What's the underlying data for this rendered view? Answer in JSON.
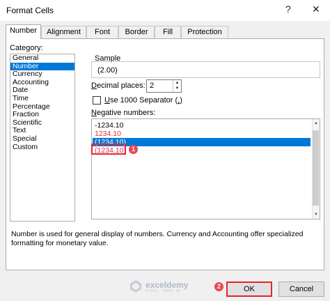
{
  "window": {
    "title": "Format Cells",
    "help": "?",
    "close": "✕"
  },
  "tabs": [
    {
      "label": "Number",
      "active": true
    },
    {
      "label": "Alignment"
    },
    {
      "label": "Font"
    },
    {
      "label": "Border"
    },
    {
      "label": "Fill"
    },
    {
      "label": "Protection"
    }
  ],
  "category": {
    "label": "Category:",
    "items": [
      "General",
      "Number",
      "Currency",
      "Accounting",
      "Date",
      "Time",
      "Percentage",
      "Fraction",
      "Scientific",
      "Text",
      "Special",
      "Custom"
    ],
    "selected": "Number"
  },
  "sample": {
    "label": "Sample",
    "value": "(2.00)"
  },
  "decimal_places": {
    "label": "Decimal places:",
    "value": "2"
  },
  "separator": {
    "label": "Use 1000 Separator (,)",
    "checked": false
  },
  "negative_numbers": {
    "label": "Negative numbers:",
    "items": [
      {
        "text": "-1234.10",
        "color": "#000000"
      },
      {
        "text": "1234.10",
        "color": "#e0303a"
      },
      {
        "text": "(1234.10)",
        "color": "#000000",
        "selected": true
      },
      {
        "text": "(1234.10)",
        "color": "#e0303a"
      }
    ]
  },
  "description": "Number is used for general display of numbers.  Currency and Accounting offer specialized formatting for monetary value.",
  "buttons": {
    "ok": "OK",
    "cancel": "Cancel"
  },
  "annotations": {
    "step1": "1",
    "step2": "2",
    "accent": "#e8242e"
  },
  "watermark": {
    "name": "exceldemy",
    "tagline": "EXCEL · DATA · BI"
  }
}
